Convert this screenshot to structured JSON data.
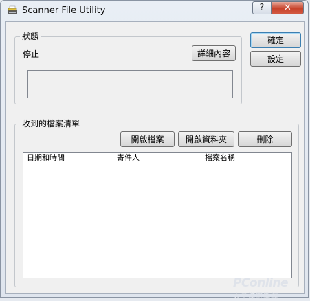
{
  "window": {
    "title": "Scanner File Utility",
    "help_glyph": "?",
    "close_glyph": "✕"
  },
  "status_group": {
    "legend": "狀態",
    "state": "停止",
    "details_button": "詳細內容"
  },
  "side_buttons": {
    "ok": "確定",
    "settings": "設定"
  },
  "file_list": {
    "legend": "收到的檔案清單",
    "open_file_button": "開啟檔案",
    "open_folder_button": "開啟資料夾",
    "delete_button": "刪除",
    "columns": [
      "日期和時間",
      "寄件人",
      "檔案名稱"
    ],
    "rows": []
  },
  "watermark": {
    "brand": "PConline",
    "sub": "太平洋電腦網"
  },
  "icons": {
    "app": "scanner-icon",
    "help": "help-icon",
    "close": "close-icon"
  }
}
